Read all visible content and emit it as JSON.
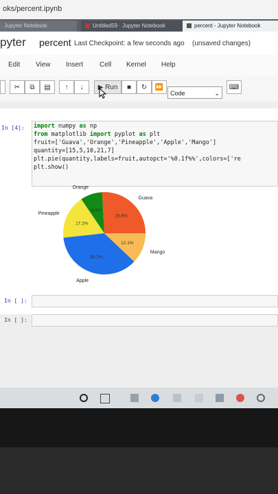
{
  "browser": {
    "url": "oks/percent.ipynb",
    "tabs": [
      {
        "label": "Jupyter Notebook"
      },
      {
        "label": "Untitled59 · Jupyter Notebook"
      },
      {
        "label": "percent - Jupyter Notebook"
      }
    ]
  },
  "header": {
    "logo": "pyter",
    "notebook_name": "percent",
    "checkpoint": "Last Checkpoint: a few seconds ago",
    "save_status": "(unsaved changes)"
  },
  "menu": [
    "Edit",
    "View",
    "Insert",
    "Cell",
    "Kernel",
    "Help"
  ],
  "toolbar": {
    "run_label": "Run",
    "cell_type": "Code",
    "icons": [
      "cut-icon",
      "copy-icon",
      "paste-icon",
      "move-up-icon",
      "move-down-icon",
      "run-icon",
      "stop-icon",
      "restart-icon",
      "fast-forward-icon",
      "keyboard-icon"
    ]
  },
  "cells": {
    "code_prompt": "In [4]:",
    "code_lines": [
      "import numpy as np",
      "from matplotlib import pyplot as plt",
      "fruit=['Guava','Orange','Pineapple','Apple','Mango']",
      "quantity=[15,5,10,21,7]",
      "plt.pie(quantity,labels=fruit,autopct='%0.1f%%',colors=['re",
      "plt.show()"
    ],
    "empty_prompts": [
      "In [ ]:",
      "In [ ]:"
    ]
  },
  "chart_data": {
    "type": "pie",
    "title": "",
    "labels": [
      "Guava",
      "Orange",
      "Pineapple",
      "Apple",
      "Mango"
    ],
    "values": [
      15,
      5,
      10,
      21,
      7
    ],
    "percent_labels": [
      "25.9%",
      "8.6%",
      "17.2%",
      "36.2%",
      "12.1%"
    ],
    "colors": [
      "#f05a28",
      "#138a13",
      "#f3e53c",
      "#1f6fe8",
      "#f8bb55"
    ]
  }
}
